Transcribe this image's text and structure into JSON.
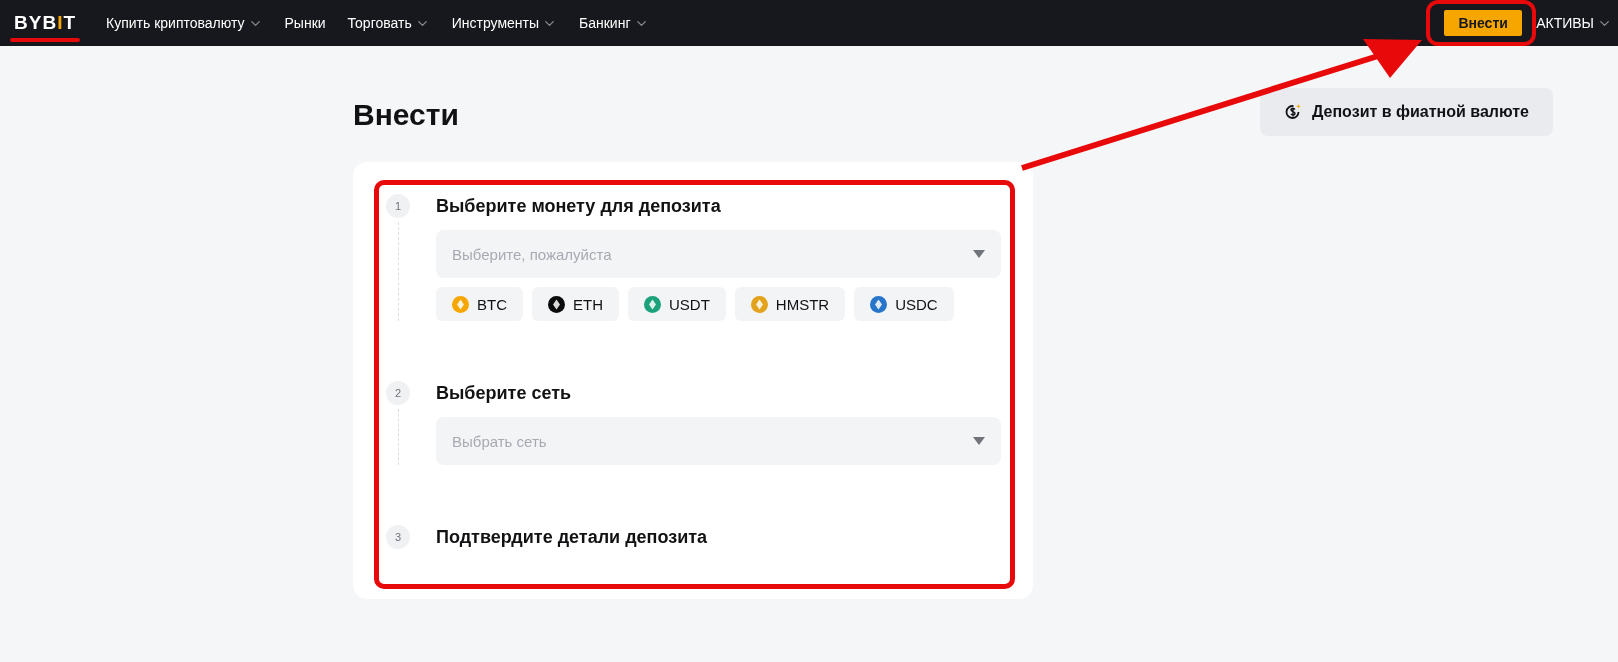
{
  "header": {
    "logo": {
      "text": "BYBIT",
      "underlined": true
    },
    "nav": [
      {
        "label": "Купить криптовалюту",
        "has_menu": true
      },
      {
        "label": "Рынки",
        "has_menu": false
      },
      {
        "label": "Торговать",
        "has_menu": true
      },
      {
        "label": "Инструменты",
        "has_menu": true
      },
      {
        "label": "Банкинг",
        "has_menu": true
      }
    ],
    "deposit_button": {
      "label": "Внести",
      "circled": true
    },
    "assets": {
      "label": "АКТИВЫ",
      "has_menu": true
    }
  },
  "page": {
    "title": "Внести",
    "fiat_button": "Депозит в фиатной валюте",
    "arrow": true
  },
  "steps_highlighted": true,
  "steps": [
    {
      "number": "1",
      "title": "Выберите монету для депозита",
      "kind": "coin",
      "placeholder": "Выберите, пожалуйста",
      "coins": [
        {
          "label": "BTC",
          "color": "#f7a600"
        },
        {
          "label": "ETH",
          "color": "#0b0b0b"
        },
        {
          "label": "USDT",
          "color": "#1ba27a"
        },
        {
          "label": "HMSTR",
          "color": "#e2a21c"
        },
        {
          "label": "USDC",
          "color": "#2775ca"
        }
      ]
    },
    {
      "number": "2",
      "title": "Выберите сеть",
      "kind": "select",
      "placeholder": "Выбрать сеть"
    },
    {
      "number": "3",
      "title": "Подтвердите детали депозита",
      "kind": "heading"
    }
  ]
}
